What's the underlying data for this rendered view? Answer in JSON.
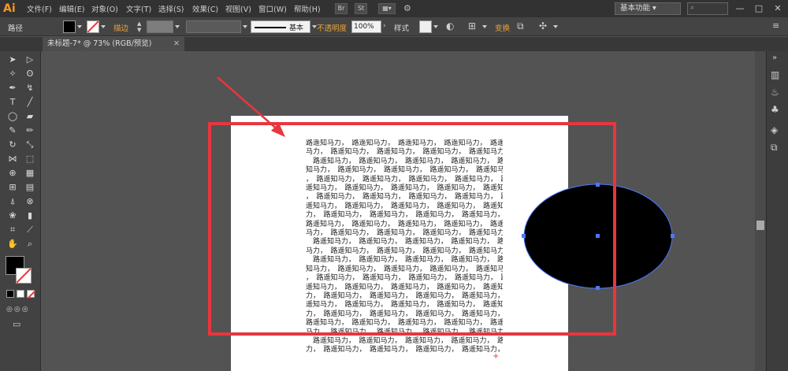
{
  "app": {
    "logo": "Ai"
  },
  "menubar": {
    "items": [
      "文件(F)",
      "编辑(E)",
      "对象(O)",
      "文字(T)",
      "选择(S)",
      "效果(C)",
      "视图(V)",
      "窗口(W)",
      "帮助(H)"
    ],
    "br_label": "Br",
    "st_label": "St",
    "workspace": "基本功能"
  },
  "controlbar": {
    "selection": "路径",
    "stroke_label": "描边",
    "profile": "基本",
    "opacity_label": "不透明度",
    "opacity_value": "100%",
    "style_label": "样式",
    "transform_label": "变换"
  },
  "document": {
    "tab_title": "未标题-7* @ 73% (RGB/预览)"
  },
  "canvas": {
    "text_unit": "路遥知马力，",
    "last_line": "力，　路遥知马力，　路遥知马力，　路遥知马力，　路遥知马力，　路遥",
    "overflow_marker": "+",
    "colors": {
      "highlight": "#e8363e",
      "ellipse_fill": "#000000",
      "selection": "#4a78ff"
    }
  }
}
